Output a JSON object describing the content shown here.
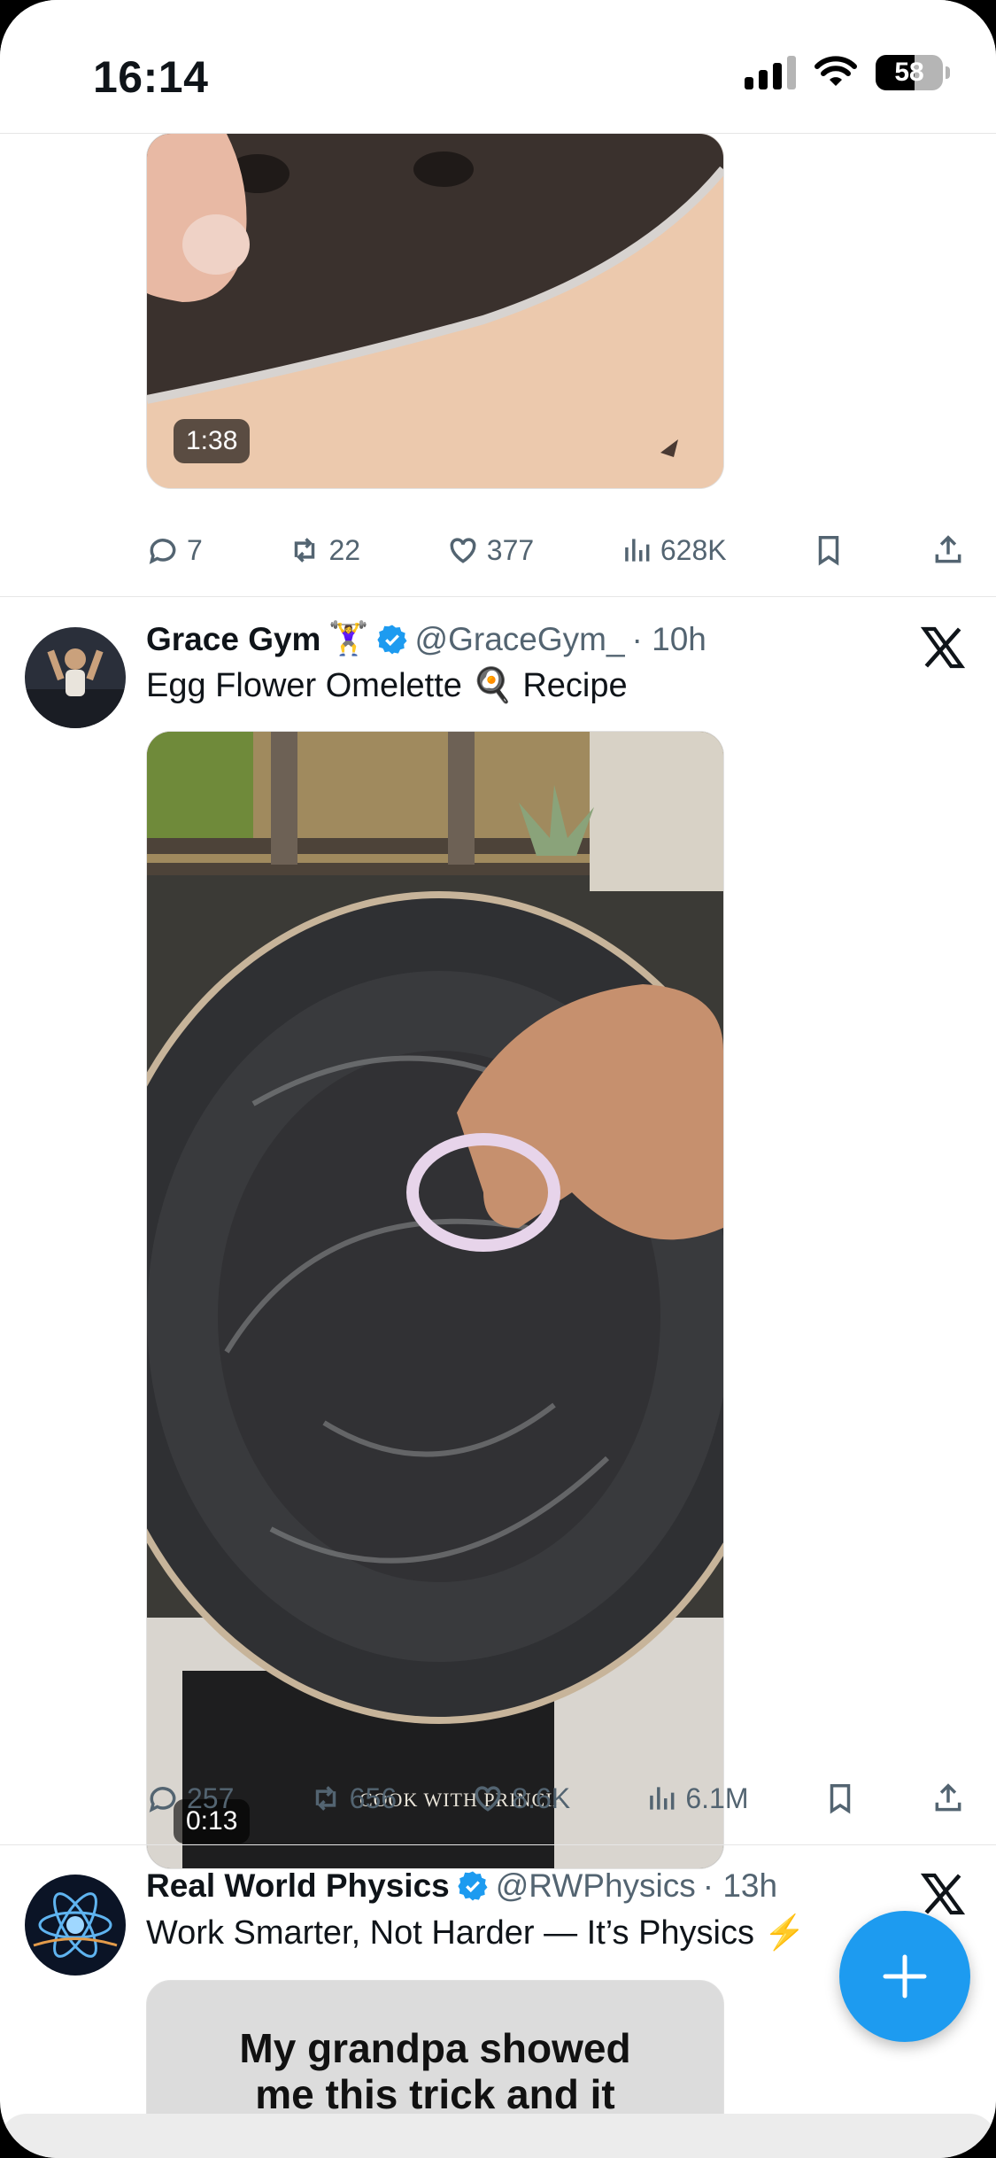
{
  "status_bar": {
    "time": "16:14",
    "battery": "58"
  },
  "tweets": [
    {
      "video_duration": "1:38",
      "stats": {
        "replies": "7",
        "retweets": "22",
        "likes": "377",
        "views": "628K"
      }
    },
    {
      "author": "Grace Gym",
      "author_emoji": "🏋️‍♀️",
      "handle": "@GraceGym_",
      "time": "· 10h",
      "text": "Egg Flower Omelette 🍳 Recipe",
      "video_duration": "0:13",
      "watermark": "COOK WITH PRINCIA",
      "stats": {
        "replies": "257",
        "retweets": "656",
        "likes": "8.6K",
        "views": "6.1M"
      }
    },
    {
      "author": "Real World Physics",
      "handle": "@RWPhysics",
      "time": "· 13h",
      "text": "Work Smarter, Not Harder — It’s Physics ⚡",
      "media_caption_line1": "My grandpa showed",
      "media_caption_line2": "me this trick and it"
    }
  ],
  "colors": {
    "accent": "#1d9bf0",
    "secondary_text": "#536471"
  }
}
